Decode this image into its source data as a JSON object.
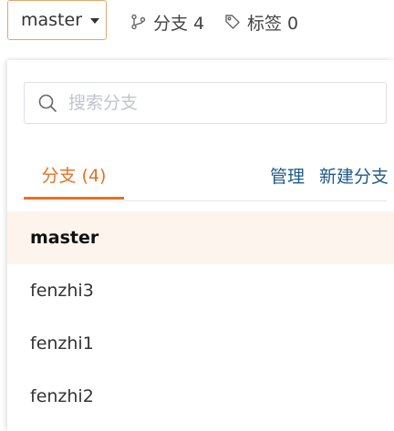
{
  "branch_selector": {
    "current": "master"
  },
  "meta": {
    "branches_label": "分支 4",
    "tags_label": "标签 0"
  },
  "dropdown": {
    "search": {
      "placeholder": "搜索分支",
      "value": ""
    },
    "tab": {
      "label": "分支 (4)"
    },
    "actions": {
      "manage_label": "管理",
      "new_branch_label": "新建分支"
    },
    "branches": [
      {
        "name": "master",
        "active": true
      },
      {
        "name": "fenzhi3",
        "active": false
      },
      {
        "name": "fenzhi1",
        "active": false
      },
      {
        "name": "fenzhi2",
        "active": false
      }
    ]
  },
  "colors": {
    "accent": "#e8711c",
    "link": "#1e5a8a",
    "active_row_bg": "#fdf4ee",
    "select_border": "#e0a76e"
  },
  "icons": {
    "caret": "caret-down-icon",
    "branch": "git-branch-icon",
    "tag": "tag-icon",
    "search": "search-icon"
  }
}
